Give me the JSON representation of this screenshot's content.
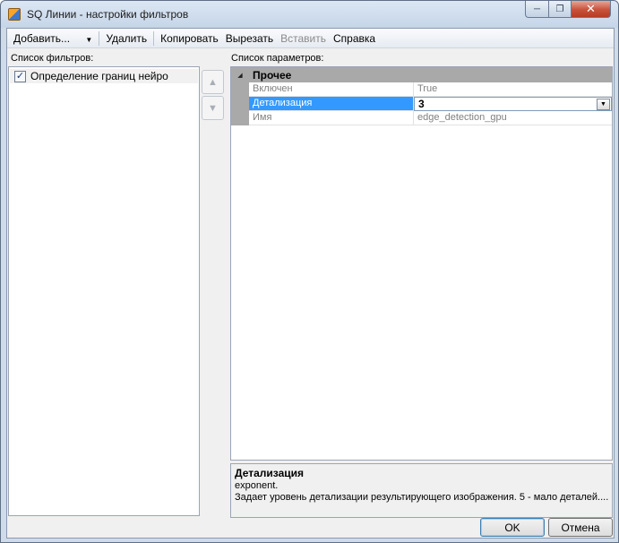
{
  "window": {
    "title": "SQ Линии - настройки фильтров",
    "icon": "app-icon"
  },
  "menu": {
    "add": "Добавить...",
    "delete": "Удалить",
    "copy": "Копировать",
    "cut": "Вырезать",
    "paste": "Вставить",
    "help": "Справка"
  },
  "filters": {
    "label": "Список фильтров:",
    "items": [
      {
        "label": "Определение границ нейро",
        "checked": true
      }
    ]
  },
  "params": {
    "label": "Список параметров:",
    "category": "Прочее",
    "rows": [
      {
        "name": "Включен",
        "value": "True"
      },
      {
        "name": "Детализация",
        "value": "3"
      },
      {
        "name": "Имя",
        "value": "edge_detection_gpu"
      }
    ]
  },
  "description": {
    "title": "Детализация",
    "line1": "exponent.",
    "line2": "Задает уровень детализации результирующего изображения. 5 - мало деталей...."
  },
  "buttons": {
    "ok": "OK",
    "cancel": "Отмена"
  },
  "colors": {
    "selection": "#3399ff",
    "category_bg": "#a9a9a9"
  }
}
